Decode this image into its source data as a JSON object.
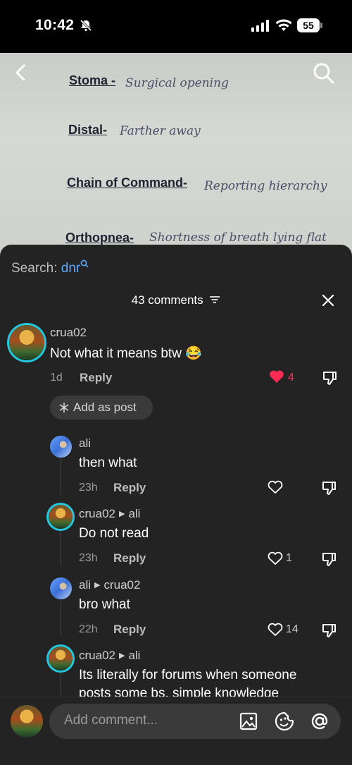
{
  "status": {
    "time": "10:42",
    "battery": "55"
  },
  "photo_notes": [
    {
      "term": "Stoma -",
      "def": "Surgical opening"
    },
    {
      "term": "Distal-",
      "def": "Farther away"
    },
    {
      "term": "Chain of Command-",
      "def": "Reporting hierarchy"
    },
    {
      "term": "Orthopnea-",
      "def": "Shortness of breath lying flat"
    }
  ],
  "search": {
    "label": "Search:",
    "query": "dnr"
  },
  "comments_header": {
    "count_label": "43 comments"
  },
  "comments": [
    {
      "user": "crua02",
      "to": "",
      "text": "Not what it means btw 😂",
      "time": "1d",
      "reply": "Reply",
      "likes": "4",
      "liked": true
    },
    {
      "user": "ali",
      "to": "",
      "text": "then what",
      "time": "23h",
      "reply": "Reply",
      "likes": "",
      "liked": false
    },
    {
      "user": "crua02",
      "to": "ali",
      "text": "Do not read",
      "time": "23h",
      "reply": "Reply",
      "likes": "1",
      "liked": false
    },
    {
      "user": "ali",
      "to": "crua02",
      "text": "bro what",
      "time": "22h",
      "reply": "Reply",
      "likes": "14",
      "liked": false
    },
    {
      "user": "crua02",
      "to": "ali",
      "text": "Its literally for forums when someone",
      "text2": "posts some bs, simple knowledge"
    }
  ],
  "add_as_post": "Add as post",
  "composer": {
    "placeholder": "Add comment..."
  },
  "colors": {
    "accent": "#5aa7ff",
    "like": "#fe2c55",
    "ring": "#22c9e0",
    "sheet": "#232323"
  },
  "icons": [
    "back-icon",
    "search-icon",
    "filter-icon",
    "close-icon",
    "heart-icon",
    "thumbs-down-icon",
    "image-icon",
    "emoji-icon",
    "at-icon"
  ]
}
